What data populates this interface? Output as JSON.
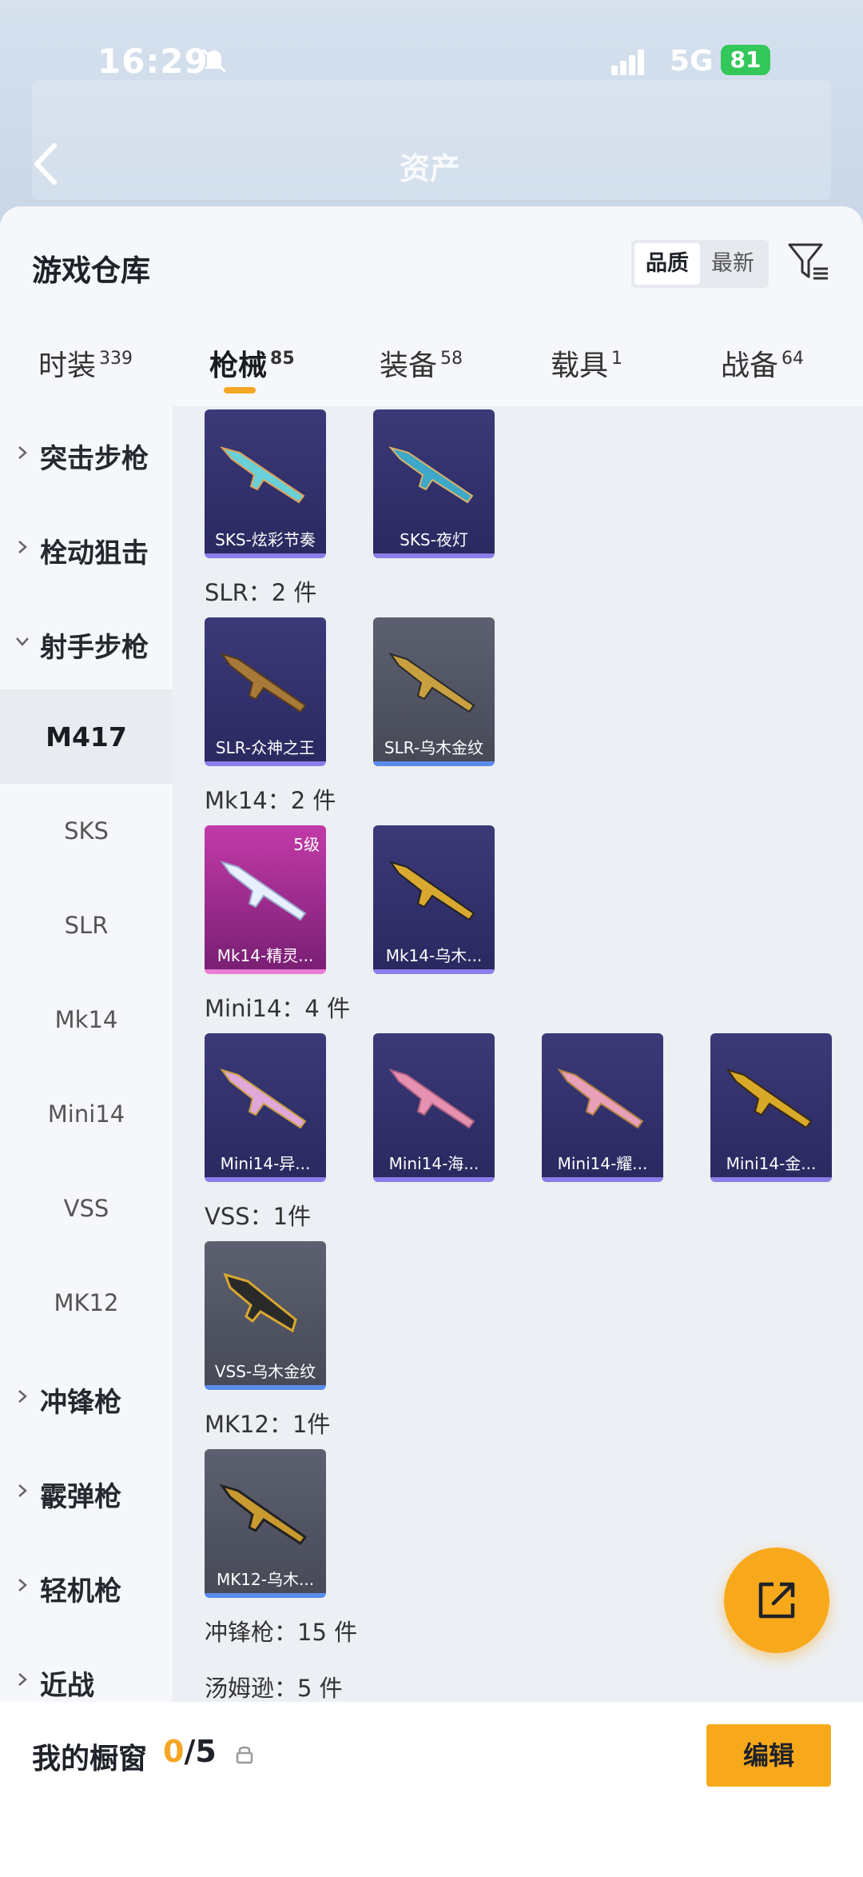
{
  "status": {
    "time": "16:29",
    "network": "5G",
    "battery": "81"
  },
  "background": {
    "asset_label": "资产"
  },
  "sheet": {
    "title": "游戏仓库"
  },
  "sort": {
    "quality": "品质",
    "newest": "最新"
  },
  "tabs": [
    {
      "label": "时装",
      "count": "339"
    },
    {
      "label": "枪械",
      "count": "85"
    },
    {
      "label": "装备",
      "count": "58"
    },
    {
      "label": "载具",
      "count": "1"
    },
    {
      "label": "战备",
      "count": "64"
    }
  ],
  "sidebar": {
    "items": [
      {
        "label": "突击步枪"
      },
      {
        "label": "栓动狙击"
      },
      {
        "label": "射手步枪"
      },
      {
        "label": "M417"
      },
      {
        "label": "SKS"
      },
      {
        "label": "SLR"
      },
      {
        "label": "Mk14"
      },
      {
        "label": "Mini14"
      },
      {
        "label": "VSS"
      },
      {
        "label": "MK12"
      },
      {
        "label": "冲锋枪"
      },
      {
        "label": "霰弹枪"
      },
      {
        "label": "轻机枪"
      },
      {
        "label": "近战"
      }
    ]
  },
  "groups": {
    "slr": "SLR：2 件",
    "mk14": "Mk14：2 件",
    "mini14": "Mini14：4 件",
    "vss": "VSS：1件",
    "mk12": "MK12：1件",
    "smg": "冲锋枪：15 件",
    "thompson": "汤姆逊：5 件"
  },
  "cards": {
    "sks1": "SKS-炫彩节奏",
    "sks2": "SKS-夜灯",
    "slr1": "SLR-众神之王",
    "slr2": "SLR-乌木金纹",
    "mk14_1": "Mk14-精灵...",
    "mk14_1_level": "5级",
    "mk14_2": "Mk14-乌木...",
    "mini1": "Mini14-异...",
    "mini2": "Mini14-海...",
    "mini3": "Mini14-耀...",
    "mini4": "Mini14-金...",
    "vss1": "VSS-乌木金纹",
    "mk12_1": "MK12-乌木..."
  },
  "showcase": {
    "label": "我的橱窗",
    "current": "0",
    "total": "/5",
    "edit": "编辑"
  }
}
